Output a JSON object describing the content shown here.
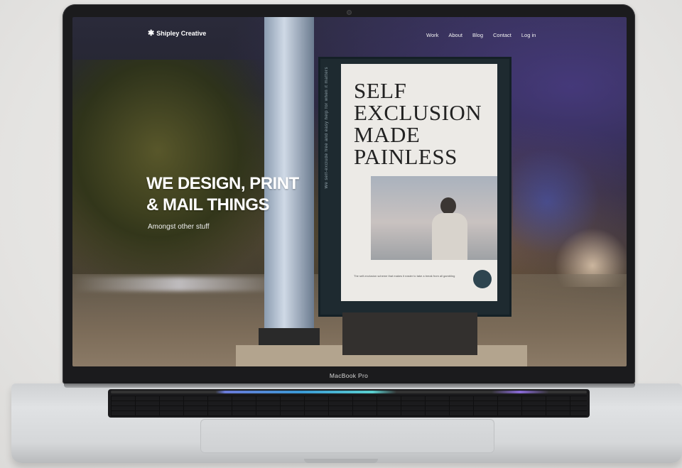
{
  "device": {
    "label": "MacBook Pro"
  },
  "nav": {
    "logo_text": "Shipley Creative",
    "logo_icon": "asterisk-icon",
    "links": [
      "Work",
      "About",
      "Blog",
      "Contact",
      "Log in"
    ]
  },
  "hero": {
    "title": "WE DESIGN, PRINT\n& MAIL THINGS",
    "subtitle": "Amongst other stuff"
  },
  "poster": {
    "title": "SELF\nEXCLUSION\nMADE\nPAINLESS",
    "caption": "The self-exclusion scheme that makes it easier to take a break from all gambling",
    "side_text": "We self-exclude free and easy help for when it matters"
  },
  "colors": {
    "accent": "#ffffff",
    "poster_bg": "#eceae6",
    "laptop": "#1b1b1d"
  }
}
